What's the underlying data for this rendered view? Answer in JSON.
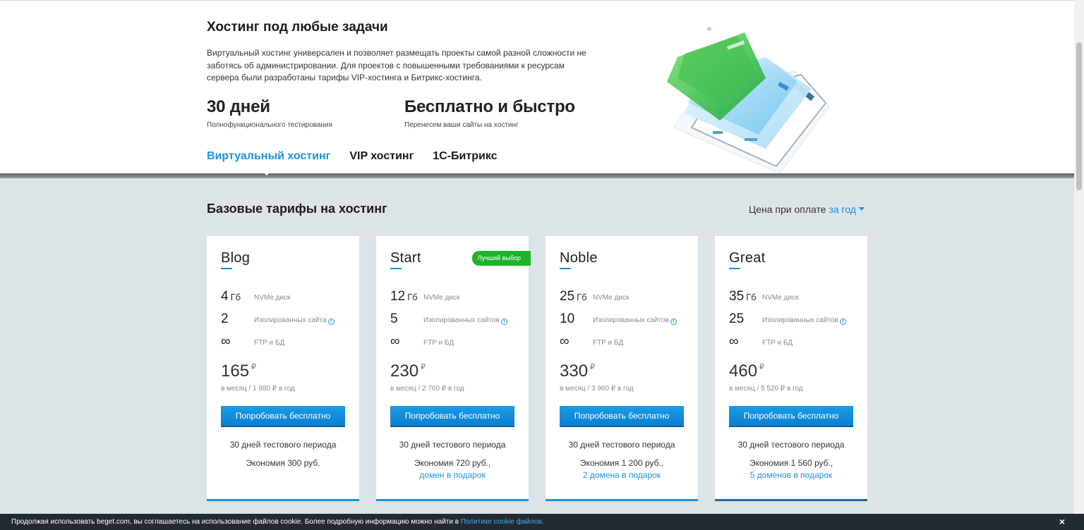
{
  "hero": {
    "title": "Хостинг под любые задачи",
    "description": "Виртуальный хостинг универсален и позволяет размещать проекты самой разной сложности не заботясь об администрировании. Для проектов с повышенными требованиями к ресурсам сервера были разработаны тарифы VIP-хостинга и Битрикс-хостинга.",
    "stats": [
      {
        "big": "30 дней",
        "small": "Полнофункционального тестирования"
      },
      {
        "big": "Бесплатно и быстро",
        "small": "Перенесем ваши сайты на хостинг"
      }
    ],
    "tabs": [
      {
        "label": "Виртуальный хостинг",
        "active": true
      },
      {
        "label": "VIP хостинг",
        "active": false
      },
      {
        "label": "1С-Битрикс",
        "active": false
      }
    ]
  },
  "section": {
    "title": "Базовые тарифы на хостинг",
    "price_prefix": "Цена при оплате",
    "price_period": "за год"
  },
  "plans": [
    {
      "name": "Blog",
      "disk_value": "4",
      "disk_unit": "Гб",
      "disk_label": "NVMe диск",
      "sites_value": "2",
      "sites_label": "Изолированных сайта",
      "ftp_value": "∞",
      "ftp_label": "FTP и БД",
      "price": "165",
      "currency": "₽",
      "price_sub": "в месяц / 1 980 ₽ в год",
      "button": "Попробовать бесплатно",
      "trial": "30 дней тестового периода",
      "savings": "Экономия 300 руб.",
      "gift": ""
    },
    {
      "name": "Start",
      "badge": "Лучший выбор",
      "disk_value": "12",
      "disk_unit": "Гб",
      "disk_label": "NVMe диск",
      "sites_value": "5",
      "sites_label": "Изолированных сайтов",
      "ftp_value": "∞",
      "ftp_label": "FTP и БД",
      "price": "230",
      "currency": "₽",
      "price_sub": "в месяц / 2 760 ₽ в год",
      "button": "Попробовать бесплатно",
      "trial": "30 дней тестового периода",
      "savings": "Экономия 720 руб.,",
      "gift": "домен в подарок"
    },
    {
      "name": "Noble",
      "disk_value": "25",
      "disk_unit": "Гб",
      "disk_label": "NVMe диск",
      "sites_value": "10",
      "sites_label": "Изолированных сайтов",
      "ftp_value": "∞",
      "ftp_label": "FTP и БД",
      "price": "330",
      "currency": "₽",
      "price_sub": "в месяц / 3 960 ₽ в год",
      "button": "Попробовать бесплатно",
      "trial": "30 дней тестового периода",
      "savings": "Экономия 1 200 руб.,",
      "gift": "2 домена в подарок"
    },
    {
      "name": "Great",
      "disk_value": "35",
      "disk_unit": "Гб",
      "disk_label": "NVMe диск",
      "sites_value": "25",
      "sites_label": "Изолированных сайтов",
      "ftp_value": "∞",
      "ftp_label": "FTP и БД",
      "price": "460",
      "currency": "₽",
      "price_sub": "в месяц / 5 520 ₽ в год",
      "button": "Попробовать бесплатно",
      "trial": "30 дней тестового периода",
      "savings": "Экономия 1 560 руб.,",
      "gift": "5 доменов в подарок"
    }
  ],
  "cookie": {
    "text": "Продолжая использовать beget.com, вы соглашаетесь на использование файлов cookie. Более подробную информацию можно найти в",
    "link": "Политике cookie файлов.",
    "close": "×"
  },
  "colors": {
    "accent": "#1b93dc",
    "badge": "#1bb52a",
    "cookie_bg": "#232a32",
    "page_bg": "#dde4e8"
  }
}
